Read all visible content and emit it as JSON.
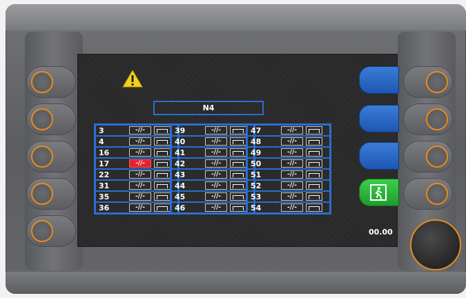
{
  "header": {
    "title": "N4"
  },
  "status": {
    "time": "00.00"
  },
  "icons": {
    "warning": "warning-triangle-icon",
    "exit": "emergency-exit-icon"
  },
  "colors": {
    "accent": "#2a6fd2",
    "alarm": "#e5212b",
    "knob_ring": "#e88b1e",
    "exit_green": "#2fb83e"
  },
  "contact_label": "-//-",
  "columns": [
    {
      "rows": [
        {
          "num": "3",
          "alarm": false
        },
        {
          "num": "4",
          "alarm": false
        },
        {
          "num": "16",
          "alarm": false
        },
        {
          "num": "17",
          "alarm": true
        },
        {
          "num": "22",
          "alarm": false
        },
        {
          "num": "31",
          "alarm": false
        },
        {
          "num": "35",
          "alarm": false
        },
        {
          "num": "36",
          "alarm": false
        }
      ]
    },
    {
      "rows": [
        {
          "num": "39",
          "alarm": false
        },
        {
          "num": "40",
          "alarm": false
        },
        {
          "num": "41",
          "alarm": false
        },
        {
          "num": "42",
          "alarm": false
        },
        {
          "num": "43",
          "alarm": false
        },
        {
          "num": "44",
          "alarm": false
        },
        {
          "num": "45",
          "alarm": false
        },
        {
          "num": "46",
          "alarm": false
        }
      ]
    },
    {
      "rows": [
        {
          "num": "47",
          "alarm": false
        },
        {
          "num": "48",
          "alarm": false
        },
        {
          "num": "49",
          "alarm": false
        },
        {
          "num": "50",
          "alarm": false
        },
        {
          "num": "51",
          "alarm": false
        },
        {
          "num": "52",
          "alarm": false
        },
        {
          "num": "53",
          "alarm": false
        },
        {
          "num": "54",
          "alarm": false
        }
      ]
    }
  ]
}
